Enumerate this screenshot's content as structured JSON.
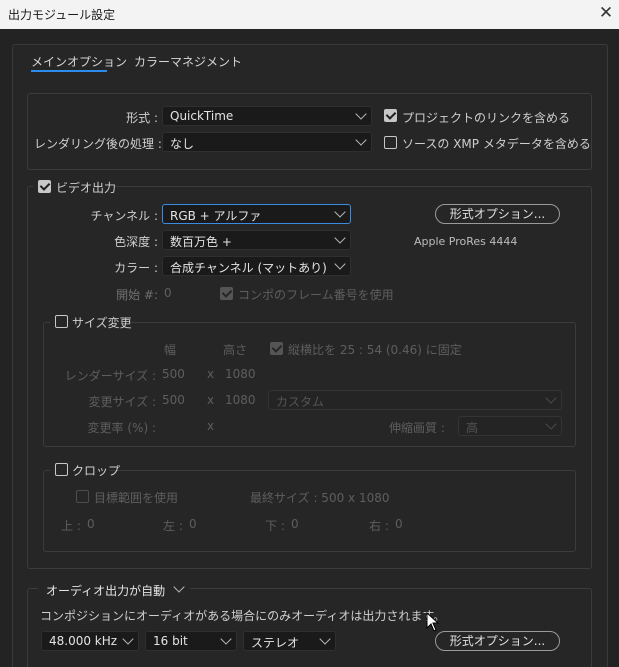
{
  "window": {
    "title": "出力モジュール設定",
    "close_glyph": "✕"
  },
  "tabs": [
    {
      "label": "メインオプション",
      "active": true
    },
    {
      "label": "カラーマネジメント",
      "active": false
    }
  ],
  "format_section": {
    "format_label": "形式 :",
    "format_value": "QuickTime",
    "post_render_label": "レンダリング後の処理 :",
    "post_render_value": "なし",
    "include_project_link": {
      "label": "プロジェクトのリンクを含める",
      "checked": true
    },
    "include_xmp": {
      "label": "ソースの XMP メタデータを含める",
      "checked": false
    }
  },
  "video_output": {
    "label": "ビデオ出力",
    "checked": true,
    "channel_label": "チャンネル :",
    "channel_value": "RGB + アルファ",
    "depth_label": "色深度 :",
    "depth_value": "数百万色 +",
    "color_label": "カラー :",
    "color_value": "合成チャンネル (マットあり)",
    "start_label": "開始 #:",
    "start_value": "0",
    "use_comp_frame": {
      "label": "コンポのフレーム番号を使用",
      "checked": true
    },
    "format_options_button": "形式オプション...",
    "codec_info": "Apple ProRes 4444"
  },
  "resize": {
    "label": "サイズ変更",
    "checked": false,
    "width_header": "幅",
    "height_header": "高さ",
    "lock_aspect": {
      "label": "縦横比を 25 : 54 (0.46) に固定",
      "checked": true
    },
    "render_size_label": "レンダーサイズ :",
    "render_w": "500",
    "render_x": "x",
    "render_h": "1080",
    "resize_to_label": "変更サイズ :",
    "resize_w": "500",
    "resize_x": "x",
    "resize_h": "1080",
    "preset_value": "カスタム",
    "resize_pct_label": "変更率 (%) :",
    "resize_pct_x": "x",
    "quality_label": "伸縮画質 :",
    "quality_value": "高"
  },
  "crop": {
    "label": "クロップ",
    "checked": false,
    "use_roi": {
      "label": "目標範囲を使用",
      "checked": false
    },
    "final_size": "最終サイズ : 500 x 1080",
    "top_label": "上 :",
    "top_value": "0",
    "left_label": "左 :",
    "left_value": "0",
    "bottom_label": "下 :",
    "bottom_value": "0",
    "right_label": "右 :",
    "right_value": "0"
  },
  "audio": {
    "mode_value": "オーディオ出力が自動",
    "note": "コンポジションにオーディオがある場合にのみオーディオは出力されます。",
    "rate_value": "48.000 kHz",
    "bits_value": "16 bit",
    "channels_value": "ステレオ",
    "format_options_button": "形式オプション..."
  }
}
